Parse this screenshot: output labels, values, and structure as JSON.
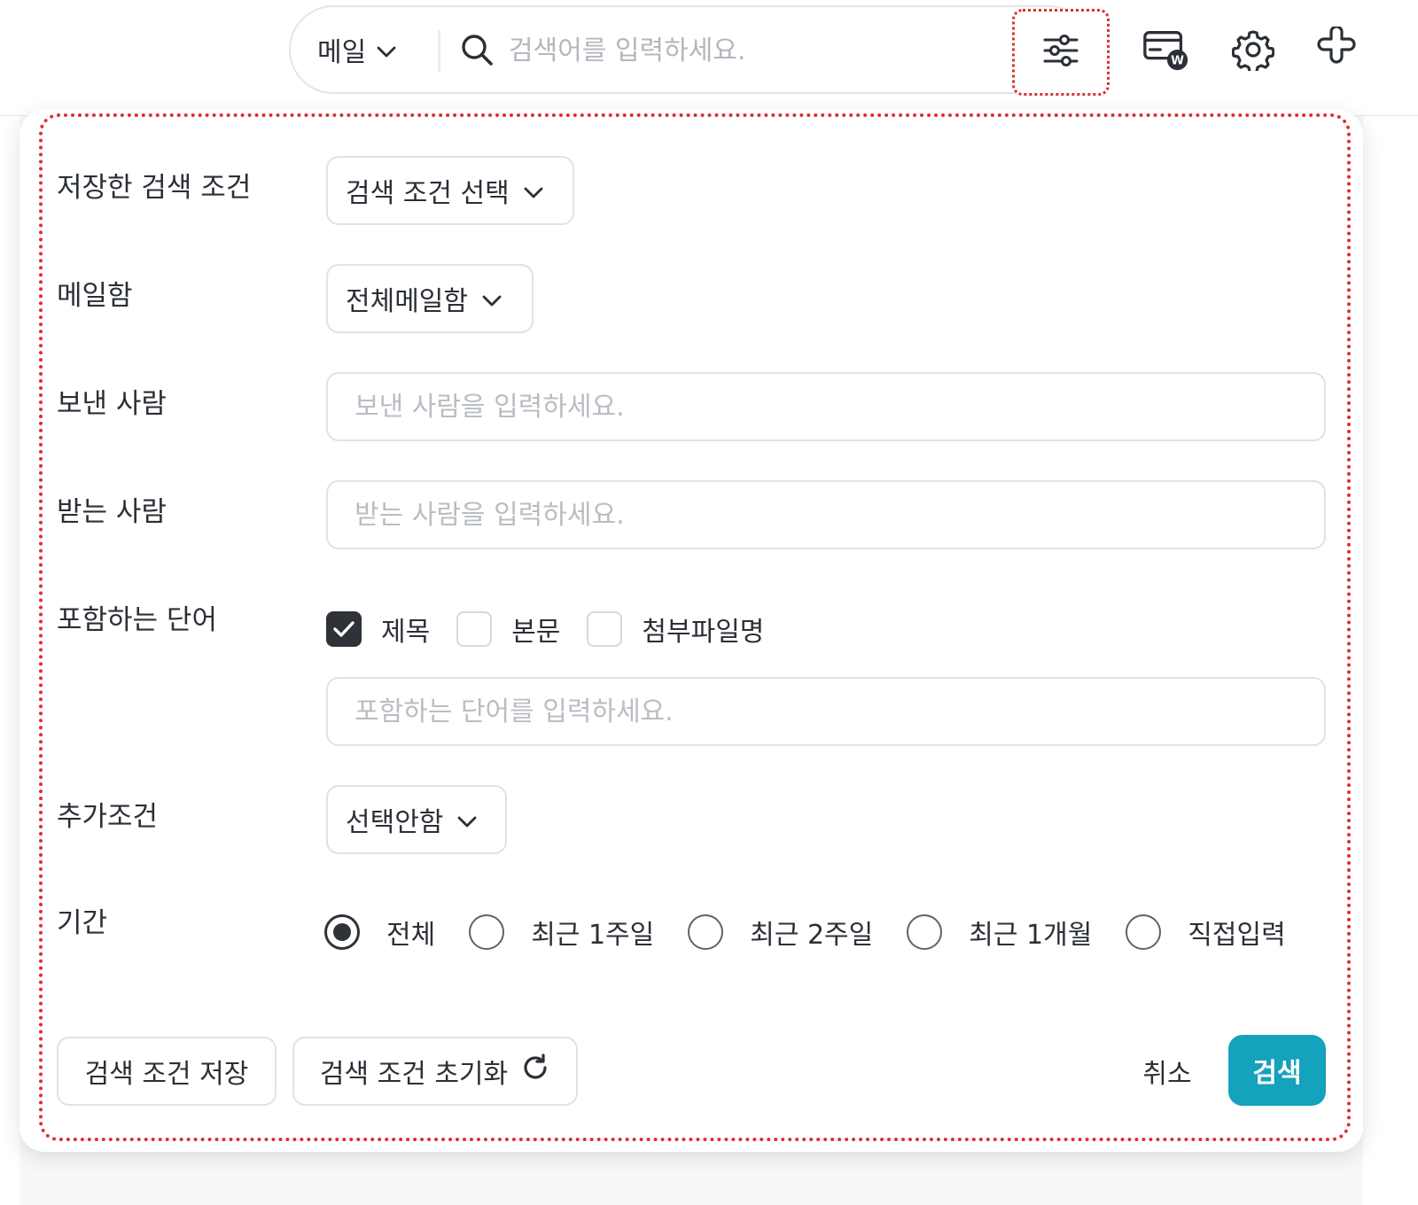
{
  "search": {
    "scope_label": "메일",
    "placeholder": "검색어를 입력하세요."
  },
  "icons": {
    "search": "search-icon",
    "filter": "sliders-icon",
    "card": "card-w-icon",
    "settings": "gear-icon",
    "extension": "puzzle-icon",
    "chevron": "chevron-down-icon",
    "refresh": "refresh-icon",
    "check": "check-icon"
  },
  "colors": {
    "accent": "#14a2bd",
    "highlight_outline": "#e02d2d",
    "checked": "#2f3338"
  },
  "filter_panel": {
    "saved_conditions": {
      "label": "저장한 검색 조건",
      "value": "검색 조건 선택"
    },
    "mailbox": {
      "label": "메일함",
      "value": "전체메일함"
    },
    "sender": {
      "label": "보낸 사람",
      "placeholder": "보낸 사람을 입력하세요."
    },
    "recipient": {
      "label": "받는 사람",
      "placeholder": "받는 사람을 입력하세요."
    },
    "keywords": {
      "label": "포함하는 단어",
      "options": [
        {
          "label": "제목",
          "checked": true
        },
        {
          "label": "본문",
          "checked": false
        },
        {
          "label": "첨부파일명",
          "checked": false
        }
      ],
      "placeholder": "포함하는 단어를 입력하세요."
    },
    "extra": {
      "label": "추가조건",
      "value": "선택안함"
    },
    "period": {
      "label": "기간",
      "options": [
        {
          "label": "전체",
          "selected": true
        },
        {
          "label": "최근 1주일",
          "selected": false
        },
        {
          "label": "최근 2주일",
          "selected": false
        },
        {
          "label": "최근 1개월",
          "selected": false
        },
        {
          "label": "직접입력",
          "selected": false
        }
      ]
    },
    "buttons": {
      "save": "검색 조건 저장",
      "reset": "검색 조건 초기화",
      "cancel": "취소",
      "search": "검색"
    }
  }
}
